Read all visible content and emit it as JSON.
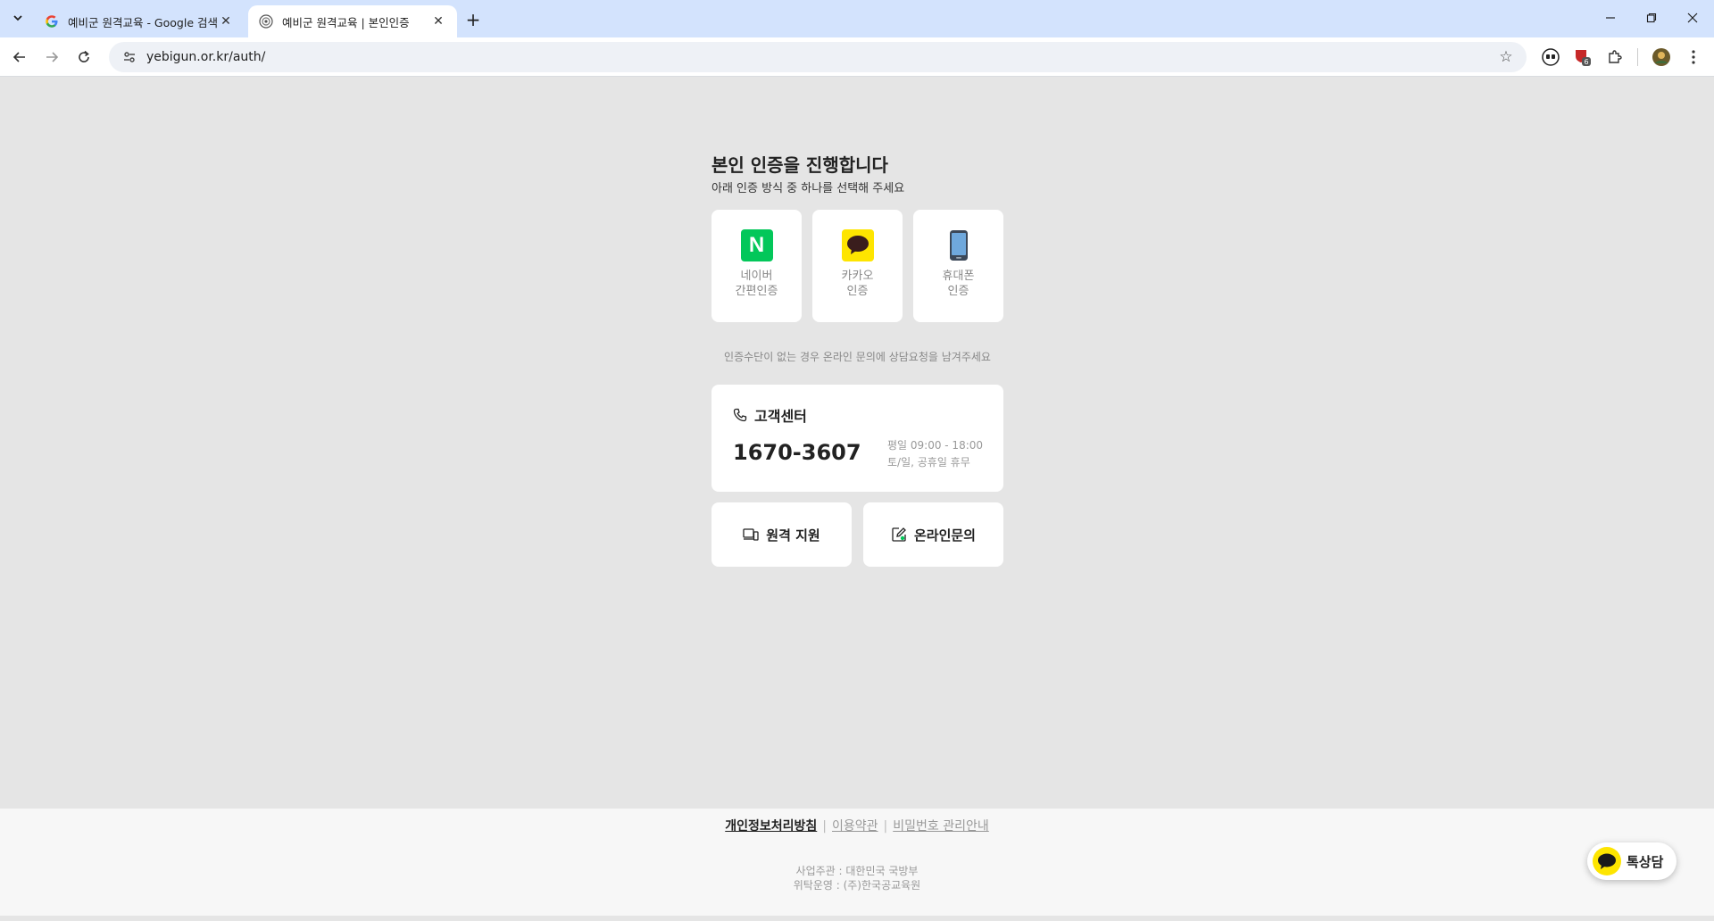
{
  "browser": {
    "tabs": [
      {
        "title": "예비군 원격교육 - Google 검색",
        "favicon": "google-g-icon"
      },
      {
        "title": "예비군 원격교육 | 본인인증",
        "favicon": "yebigun-emblem-icon"
      }
    ],
    "url": "yebigun.or.kr/auth/",
    "extension_badge": "6"
  },
  "auth": {
    "title": "본인 인증을 진행합니다",
    "subtitle": "아래 인증 방식 중 하나를 선택해 주세요",
    "methods": [
      {
        "label": "네이버\n간편인증",
        "icon": "naver-icon",
        "icon_text": "N",
        "color": "#03c75a"
      },
      {
        "label": "카카오\n인증",
        "icon": "kakao-talk-icon",
        "color": "#fee500"
      },
      {
        "label": "휴대폰\n인증",
        "icon": "mobile-phone-icon"
      }
    ],
    "notice": "인증수단이 없는 경우 온라인 문의에 상담요청을 남겨주세요"
  },
  "customer_center": {
    "title": "고객센터",
    "phone": "1670-3607",
    "hours_weekday": "평일 09:00 - 18:00",
    "hours_closed": "토/일, 공휴일 휴무"
  },
  "buttons": {
    "remote_support": "원격 지원",
    "online_inquiry": "온라인문의"
  },
  "footer": {
    "links": {
      "privacy": "개인정보처리방침",
      "terms": "이용약관",
      "password": "비밀번호 관리안내"
    },
    "organizer": "사업주관 : 대한민국 국방부",
    "operator": "위탁운영 : (주)한국공교육원"
  },
  "chat": {
    "label": "톡상담"
  }
}
